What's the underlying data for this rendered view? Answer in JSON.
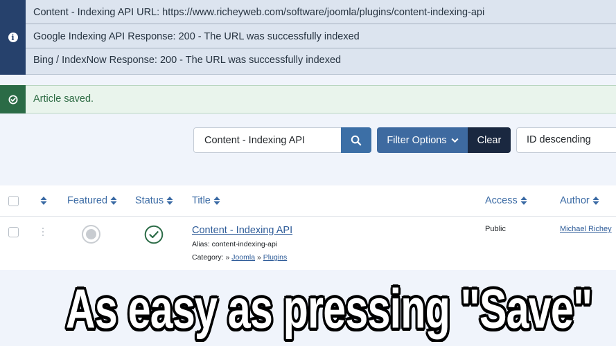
{
  "info_alert": {
    "icon": "info-icon",
    "color": "#26416c",
    "messages": [
      "Content - Indexing API URL: https://www.richeyweb.com/software/joomla/plugins/content-indexing-api",
      "Google Indexing API Response: 200 - The URL was successfully indexed",
      "Bing / IndexNow Response: 200 - The URL was successfully indexed"
    ]
  },
  "success_alert": {
    "icon": "check-circle-icon",
    "color": "#2b6b46",
    "message": "Article saved."
  },
  "toolbar": {
    "search_value": "Content - Indexing API",
    "search_icon": "search-icon",
    "filter_label": "Filter Options",
    "clear_label": "Clear",
    "sort_value": "ID descending"
  },
  "table": {
    "columns": {
      "featured": "Featured",
      "status": "Status",
      "title": "Title",
      "access": "Access",
      "author": "Author"
    },
    "rows": [
      {
        "featured": false,
        "status": "published",
        "title": "Content - Indexing API",
        "alias_label": "Alias:",
        "alias": "content-indexing-api",
        "category_label": "Category:",
        "category_sep1": "»",
        "category_1": "Joomla",
        "category_sep2": "»",
        "category_2": "Plugins",
        "access": "Public",
        "author": "Michael Richey"
      }
    ]
  },
  "caption": "As easy as pressing \"Save\""
}
